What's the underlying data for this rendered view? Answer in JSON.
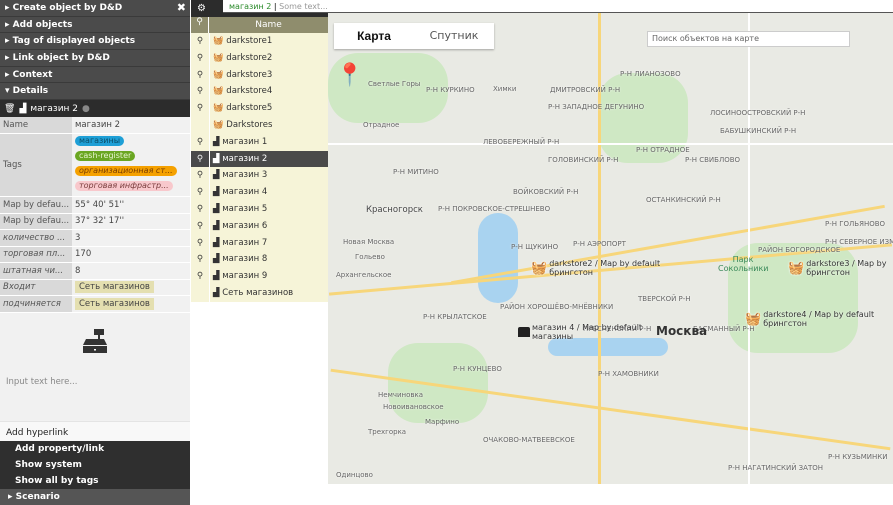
{
  "left_menu": {
    "items": [
      "Create object by D&D",
      "Add objects",
      "Tag of displayed objects",
      "Link object by D&D",
      "Context",
      "Details"
    ],
    "close": "✖"
  },
  "details": {
    "title": "магазин 2",
    "props": [
      {
        "key": "Name",
        "value": "магазин 2"
      },
      {
        "key": "Map by defau...",
        "value": "55° 40' 51''"
      },
      {
        "key": "Map by defau...",
        "value": "37° 32' 17''"
      },
      {
        "key": "количество ...",
        "value": "3"
      },
      {
        "key": "торговая пл...",
        "value": "170"
      },
      {
        "key": "штатная чи...",
        "value": "8"
      },
      {
        "key": "Входит",
        "value": "Сеть магазинов"
      },
      {
        "key": "подчиняется",
        "value": "Сеть магазинов"
      }
    ],
    "tags_label": "Tags",
    "tags": [
      {
        "text": "магазины",
        "color": "#1e9fd6"
      },
      {
        "text": "cash-register",
        "color": "#6aa622"
      },
      {
        "text": "организационная ст...",
        "color": "#f5a100"
      },
      {
        "text": "торговая инфрастр...",
        "color": "#f8c8cc"
      }
    ],
    "input_placeholder": "Input text here...",
    "add_hyperlink": "Add hyperlink"
  },
  "bottom_menu": [
    "Add property/link",
    "Show system",
    "Show all by tags"
  ],
  "scenario": "Scenario",
  "topbar": {
    "object": "магазин 2",
    "placeholder": "Some text..."
  },
  "list": {
    "header": "Name",
    "selected": "магазин 2",
    "items": [
      {
        "name": "darkstore1",
        "pin": true,
        "icon": "basket"
      },
      {
        "name": "darkstore2",
        "pin": true,
        "icon": "basket"
      },
      {
        "name": "darkstore3",
        "pin": true,
        "icon": "basket"
      },
      {
        "name": "darkstore4",
        "pin": true,
        "icon": "basket"
      },
      {
        "name": "darkstore5",
        "pin": true,
        "icon": "basket"
      },
      {
        "name": "Darkstores",
        "pin": false,
        "icon": "basket"
      },
      {
        "name": "магазин 1",
        "pin": true,
        "icon": "register"
      },
      {
        "name": "магазин 2",
        "pin": true,
        "icon": "register"
      },
      {
        "name": "магазин 3",
        "pin": true,
        "icon": "register"
      },
      {
        "name": "магазин 4",
        "pin": true,
        "icon": "register"
      },
      {
        "name": "магазин 5",
        "pin": true,
        "icon": "register"
      },
      {
        "name": "магазин 6",
        "pin": true,
        "icon": "register"
      },
      {
        "name": "магазин 7",
        "pin": true,
        "icon": "register"
      },
      {
        "name": "магазин 8",
        "pin": true,
        "icon": "register"
      },
      {
        "name": "магазин 9",
        "pin": true,
        "icon": "register"
      },
      {
        "name": "Сеть магазинов",
        "pin": false,
        "icon": "register"
      }
    ]
  },
  "map": {
    "tabs": [
      "Карта",
      "Спутник"
    ],
    "search_placeholder": "Поиск объектов на карте",
    "city": "Москва",
    "labels": [
      "Химки",
      "Р-Н КУРКИНО",
      "ДМИТРОВСКИЙ Р-Н",
      "Р-Н ЛИАНОЗОВО",
      "Р-Н ЗАПАДНОЕ ДЕГУНИНО",
      "ЛЕВОБЕРЕЖНЫЙ Р-Н",
      "ГОЛОВИНСКИЙ Р-Н",
      "Р-Н ОТРАДНОЕ",
      "Р-Н СВИБЛОВО",
      "БАБУШКИНСКИЙ Р-Н",
      "ЛОСИНООСТРОВСКИЙ Р-Н",
      "Р-Н МИТИНО",
      "Красногорск",
      "ВОЙКОВСКИЙ Р-Н",
      "ОСТАНКИНСКИЙ Р-Н",
      "Р-Н ПОКРОВСКОЕ-СТРЕШНЕВО",
      "Р-Н ЩУКИНО",
      "Р-Н АЭРОПОРТ",
      "РАЙОН БОГОРОДСКОЕ",
      "Р-Н ГОЛЬЯНОВО",
      "Р-Н СЕВЕРНОЕ ИЗМАЙЛОВО",
      "Новая Москва",
      "Гольево",
      "Архангельское",
      "РАЙОН ХОРОШЁВО-МНЁВНИКИ",
      "ТВЕРСКОЙ Р-Н",
      "Р-Н КРЫЛАТСКОЕ",
      "ПРЕСНЕНСКИЙ Р-Н",
      "БАСМАННЫЙ Р-Н",
      "Р-Н КУНЦЕВО",
      "Р-Н ХАМОВНИКИ",
      "Немчиновка",
      "Новоивановское",
      "Марфино",
      "Трехгорка",
      "ОЧАКОВО-МАТВЕЕВСКОЕ",
      "Одинцово",
      "Р-Н КУЗЬМИНКИ",
      "Р-Н НАГАТИНСКИЙ ЗАТОН",
      "Светлые Горы",
      "Отрадное"
    ],
    "park": "Парк Сокольники",
    "markers": [
      {
        "label": "darkstore2 / Map by default",
        "sub": "брингстон",
        "icon": "basket"
      },
      {
        "label": "darkstore3 / Map by",
        "sub": "брингстон",
        "icon": "basket"
      },
      {
        "label": "darkstore4 / Map by default",
        "sub": "брингстон",
        "icon": "basket"
      },
      {
        "label": "магазин 4 / Map by default",
        "sub": "магазины",
        "icon": "register"
      }
    ]
  }
}
